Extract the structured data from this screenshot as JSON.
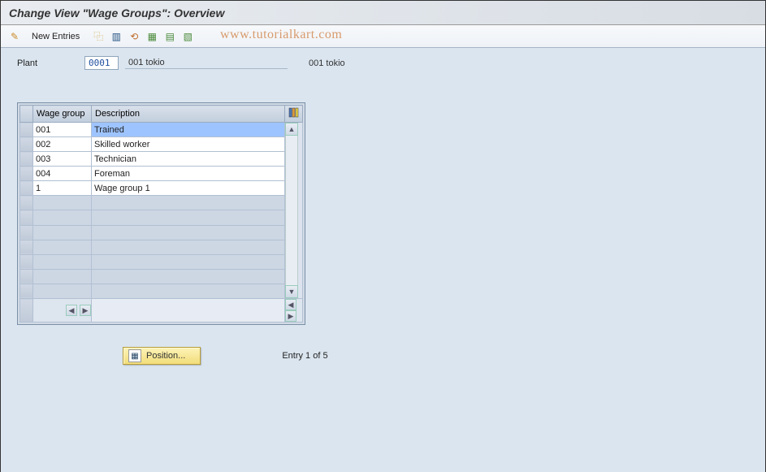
{
  "title": "Change View \"Wage Groups\": Overview",
  "toolbar": {
    "new_entries_label": "New Entries"
  },
  "watermark": "www.tutorialkart.com",
  "plant": {
    "label": "Plant",
    "code": "0001",
    "desc1": "001 tokio",
    "desc2": "001 tokio"
  },
  "grid": {
    "headers": {
      "wage_group": "Wage group",
      "description": "Description"
    },
    "rows": [
      {
        "wg": "001",
        "desc": "Trained",
        "selected": true
      },
      {
        "wg": "002",
        "desc": "Skilled worker"
      },
      {
        "wg": "003",
        "desc": "Technician"
      },
      {
        "wg": "004",
        "desc": "Foreman"
      },
      {
        "wg": "1",
        "desc": "Wage group 1"
      }
    ],
    "empty_rows": 7
  },
  "footer": {
    "position_label": "Position...",
    "entry_text": "Entry 1 of 5"
  }
}
